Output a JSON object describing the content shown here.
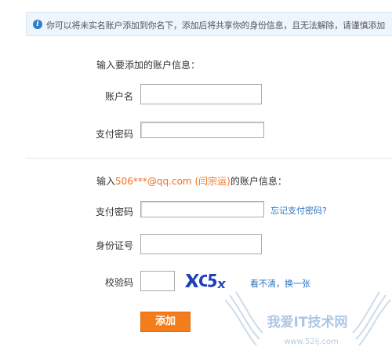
{
  "notice": {
    "icon": "info-icon",
    "text": "你可以将未实名账户添加到你名下，添加后将共享你的身份信息，且无法解除，请谨慎添加"
  },
  "section1": {
    "title": "输入要添加的账户信息：",
    "account_name_label": "账户名",
    "account_name_value": "",
    "pay_password_label": "支付密码",
    "pay_password_value": ""
  },
  "section2": {
    "title_prefix": "输入",
    "account_email": "506***@qq.com",
    "account_owner": "(闫宗运)",
    "title_suffix": "的账户信息：",
    "pay_password_label": "支付密码",
    "pay_password_value": "",
    "forgot_password_link": "忘记支付密码?",
    "id_number_label": "身份证号",
    "id_number_value": "",
    "captcha_label": "校验码",
    "captcha_value": "",
    "captcha_image_text": "XC5x",
    "refresh_captcha_link": "看不清，换一张",
    "submit_label": "添加"
  },
  "watermark": {
    "title": "我爱IT技术网",
    "url": "www.52ij.com"
  },
  "colors": {
    "accent_orange": "#f47d1b",
    "link_blue": "#2a72c2",
    "notice_bg": "#eef6fd",
    "captcha_blue": "#1f3fb8"
  }
}
